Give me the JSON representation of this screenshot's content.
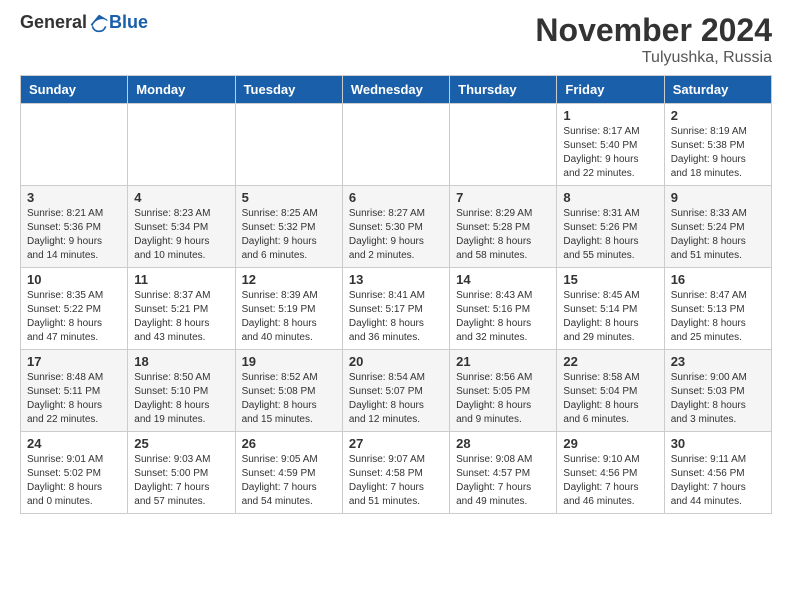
{
  "header": {
    "logo_general": "General",
    "logo_blue": "Blue",
    "month_title": "November 2024",
    "location": "Tulyushka, Russia"
  },
  "weekdays": [
    "Sunday",
    "Monday",
    "Tuesday",
    "Wednesday",
    "Thursday",
    "Friday",
    "Saturday"
  ],
  "weeks": [
    [
      {
        "day": "",
        "info": ""
      },
      {
        "day": "",
        "info": ""
      },
      {
        "day": "",
        "info": ""
      },
      {
        "day": "",
        "info": ""
      },
      {
        "day": "",
        "info": ""
      },
      {
        "day": "1",
        "info": "Sunrise: 8:17 AM\nSunset: 5:40 PM\nDaylight: 9 hours and 22 minutes."
      },
      {
        "day": "2",
        "info": "Sunrise: 8:19 AM\nSunset: 5:38 PM\nDaylight: 9 hours and 18 minutes."
      }
    ],
    [
      {
        "day": "3",
        "info": "Sunrise: 8:21 AM\nSunset: 5:36 PM\nDaylight: 9 hours and 14 minutes."
      },
      {
        "day": "4",
        "info": "Sunrise: 8:23 AM\nSunset: 5:34 PM\nDaylight: 9 hours and 10 minutes."
      },
      {
        "day": "5",
        "info": "Sunrise: 8:25 AM\nSunset: 5:32 PM\nDaylight: 9 hours and 6 minutes."
      },
      {
        "day": "6",
        "info": "Sunrise: 8:27 AM\nSunset: 5:30 PM\nDaylight: 9 hours and 2 minutes."
      },
      {
        "day": "7",
        "info": "Sunrise: 8:29 AM\nSunset: 5:28 PM\nDaylight: 8 hours and 58 minutes."
      },
      {
        "day": "8",
        "info": "Sunrise: 8:31 AM\nSunset: 5:26 PM\nDaylight: 8 hours and 55 minutes."
      },
      {
        "day": "9",
        "info": "Sunrise: 8:33 AM\nSunset: 5:24 PM\nDaylight: 8 hours and 51 minutes."
      }
    ],
    [
      {
        "day": "10",
        "info": "Sunrise: 8:35 AM\nSunset: 5:22 PM\nDaylight: 8 hours and 47 minutes."
      },
      {
        "day": "11",
        "info": "Sunrise: 8:37 AM\nSunset: 5:21 PM\nDaylight: 8 hours and 43 minutes."
      },
      {
        "day": "12",
        "info": "Sunrise: 8:39 AM\nSunset: 5:19 PM\nDaylight: 8 hours and 40 minutes."
      },
      {
        "day": "13",
        "info": "Sunrise: 8:41 AM\nSunset: 5:17 PM\nDaylight: 8 hours and 36 minutes."
      },
      {
        "day": "14",
        "info": "Sunrise: 8:43 AM\nSunset: 5:16 PM\nDaylight: 8 hours and 32 minutes."
      },
      {
        "day": "15",
        "info": "Sunrise: 8:45 AM\nSunset: 5:14 PM\nDaylight: 8 hours and 29 minutes."
      },
      {
        "day": "16",
        "info": "Sunrise: 8:47 AM\nSunset: 5:13 PM\nDaylight: 8 hours and 25 minutes."
      }
    ],
    [
      {
        "day": "17",
        "info": "Sunrise: 8:48 AM\nSunset: 5:11 PM\nDaylight: 8 hours and 22 minutes."
      },
      {
        "day": "18",
        "info": "Sunrise: 8:50 AM\nSunset: 5:10 PM\nDaylight: 8 hours and 19 minutes."
      },
      {
        "day": "19",
        "info": "Sunrise: 8:52 AM\nSunset: 5:08 PM\nDaylight: 8 hours and 15 minutes."
      },
      {
        "day": "20",
        "info": "Sunrise: 8:54 AM\nSunset: 5:07 PM\nDaylight: 8 hours and 12 minutes."
      },
      {
        "day": "21",
        "info": "Sunrise: 8:56 AM\nSunset: 5:05 PM\nDaylight: 8 hours and 9 minutes."
      },
      {
        "day": "22",
        "info": "Sunrise: 8:58 AM\nSunset: 5:04 PM\nDaylight: 8 hours and 6 minutes."
      },
      {
        "day": "23",
        "info": "Sunrise: 9:00 AM\nSunset: 5:03 PM\nDaylight: 8 hours and 3 minutes."
      }
    ],
    [
      {
        "day": "24",
        "info": "Sunrise: 9:01 AM\nSunset: 5:02 PM\nDaylight: 8 hours and 0 minutes."
      },
      {
        "day": "25",
        "info": "Sunrise: 9:03 AM\nSunset: 5:00 PM\nDaylight: 7 hours and 57 minutes."
      },
      {
        "day": "26",
        "info": "Sunrise: 9:05 AM\nSunset: 4:59 PM\nDaylight: 7 hours and 54 minutes."
      },
      {
        "day": "27",
        "info": "Sunrise: 9:07 AM\nSunset: 4:58 PM\nDaylight: 7 hours and 51 minutes."
      },
      {
        "day": "28",
        "info": "Sunrise: 9:08 AM\nSunset: 4:57 PM\nDaylight: 7 hours and 49 minutes."
      },
      {
        "day": "29",
        "info": "Sunrise: 9:10 AM\nSunset: 4:56 PM\nDaylight: 7 hours and 46 minutes."
      },
      {
        "day": "30",
        "info": "Sunrise: 9:11 AM\nSunset: 4:56 PM\nDaylight: 7 hours and 44 minutes."
      }
    ]
  ]
}
